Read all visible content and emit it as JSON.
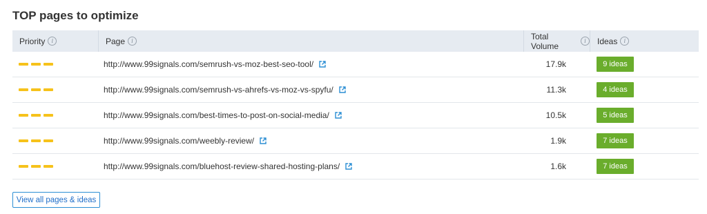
{
  "title": "TOP pages to optimize",
  "columns": {
    "priority": "Priority",
    "page": "Page",
    "volume": "Total Volume",
    "ideas": "Ideas"
  },
  "info_glyph": "i",
  "rows": [
    {
      "url": "http://www.99signals.com/semrush-vs-moz-best-seo-tool/",
      "volume": "17.9k",
      "ideas": "9 ideas"
    },
    {
      "url": "http://www.99signals.com/semrush-vs-ahrefs-vs-moz-vs-spyfu/",
      "volume": "11.3k",
      "ideas": "4 ideas"
    },
    {
      "url": "http://www.99signals.com/best-times-to-post-on-social-media/",
      "volume": "10.5k",
      "ideas": "5 ideas"
    },
    {
      "url": "http://www.99signals.com/weebly-review/",
      "volume": "1.9k",
      "ideas": "7 ideas"
    },
    {
      "url": "http://www.99signals.com/bluehost-review-shared-hosting-plans/",
      "volume": "1.6k",
      "ideas": "7 ideas"
    }
  ],
  "view_all_label": "View all pages & ideas",
  "colors": {
    "priority": "#f6c21b",
    "ideas_button": "#6aad2c",
    "header_bg": "#e6ebf1",
    "link_icon": "#2b8ed4"
  },
  "icons": {
    "info": "info-icon",
    "external_link": "external-link-icon",
    "priority": "priority-dashes-icon"
  }
}
